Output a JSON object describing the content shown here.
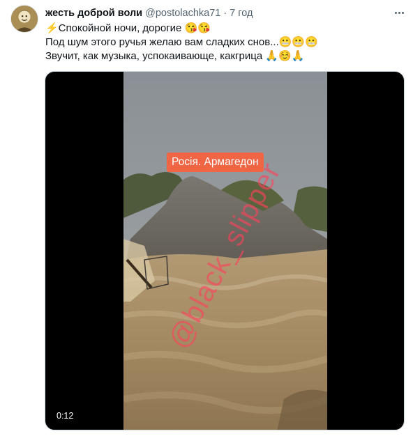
{
  "tweet": {
    "display_name": "жесть доброй воли",
    "handle": "@postolachka71",
    "separator": "·",
    "time": "7 год",
    "more_icon": "more-horizontal-icon",
    "lines": [
      "⚡Спокойной ночи, дорогие 😘😘",
      "Под шум этого ручья желаю вам сладких снов...😬😬😬",
      "Звучит, как музыка, успокаивающе, какгрица 🙏☺️🙏"
    ]
  },
  "video": {
    "caption": "Росія. Армагедон",
    "watermark": "@black_slipper",
    "duration": "0:12"
  },
  "colors": {
    "caption_bg": "#f06543",
    "watermark": "#ff405a",
    "secondary_text": "#536471",
    "primary_text": "#0f1419"
  }
}
